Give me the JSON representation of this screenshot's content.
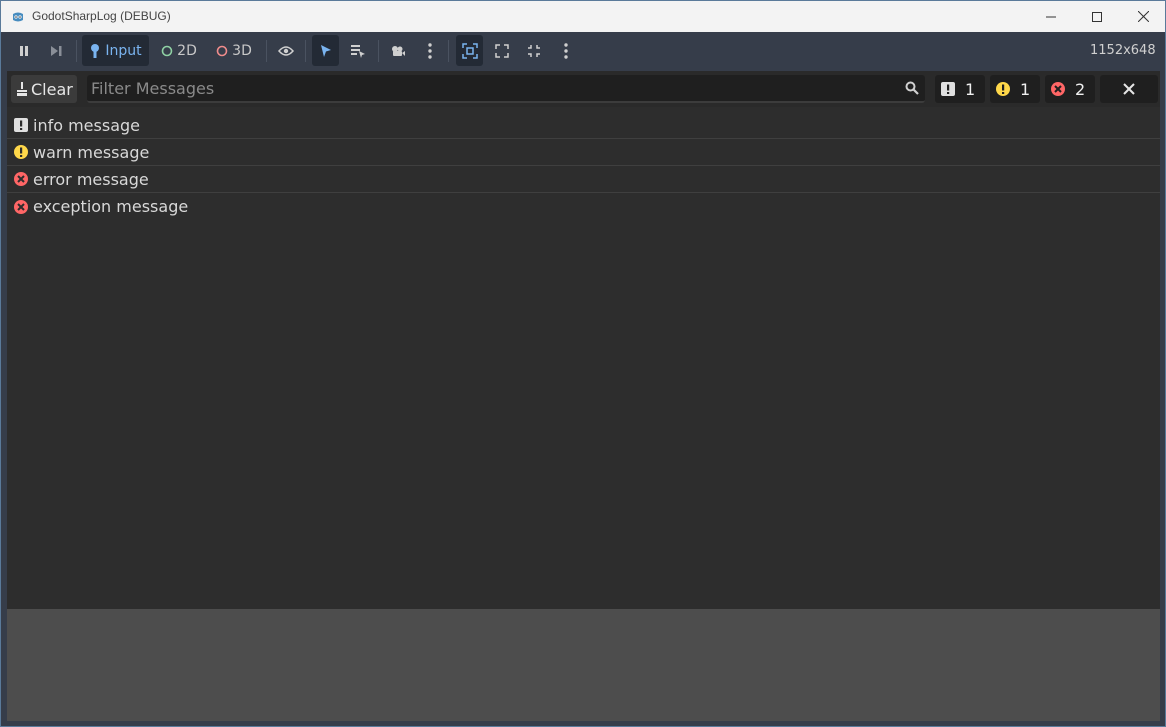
{
  "window": {
    "title": "GodotSharpLog (DEBUG)"
  },
  "toolbar": {
    "input_label": "Input",
    "mode_2d_label": "2D",
    "mode_3d_label": "3D",
    "resolution": "1152x648"
  },
  "log_panel": {
    "clear_label": "Clear",
    "filter_placeholder": "Filter Messages",
    "filter_value": "",
    "counts": {
      "info": "1",
      "warn": "1",
      "error": "2"
    },
    "messages": [
      {
        "level": "info",
        "text": "info message"
      },
      {
        "level": "warn",
        "text": "warn message"
      },
      {
        "level": "error",
        "text": "error message"
      },
      {
        "level": "error",
        "text": "exception message"
      }
    ]
  },
  "colors": {
    "info": "#e0e0e0",
    "warn": "#ffd84a",
    "error": "#ff6666",
    "accent": "#7ab4f0"
  }
}
